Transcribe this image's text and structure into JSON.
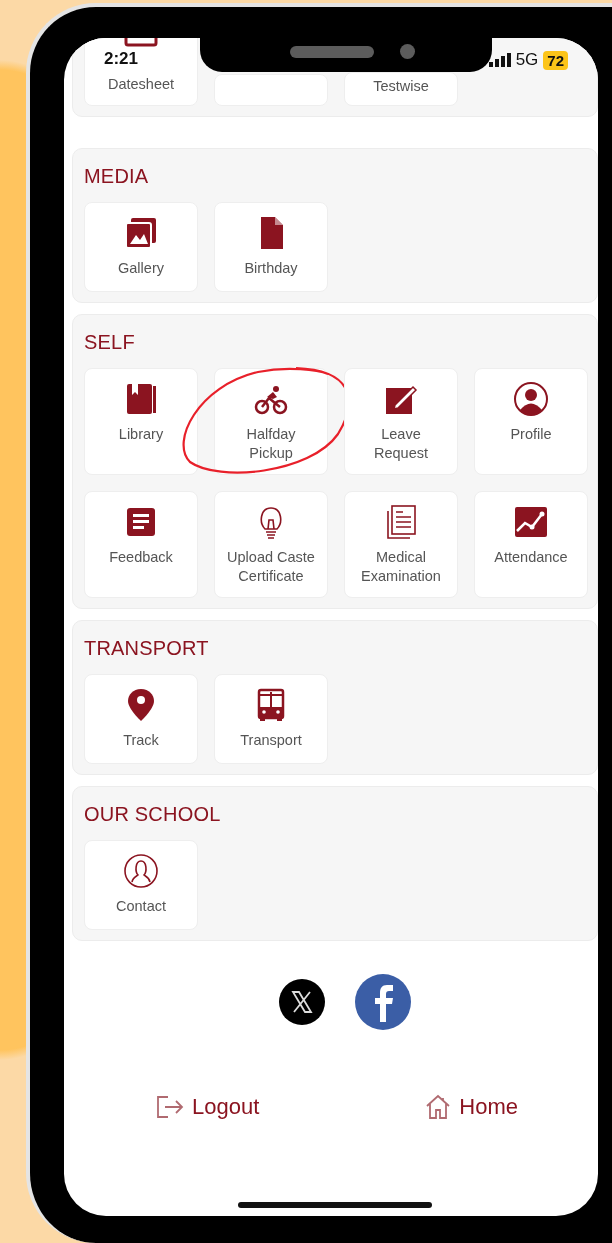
{
  "status_bar": {
    "time": "2:21",
    "network": "5G",
    "battery": "72"
  },
  "sections": [
    {
      "tiles": [
        {
          "label": "Datesheet",
          "kind": "calendar",
          "circled": false
        },
        {
          "kind": "hidden",
          "circled": false
        },
        {
          "label": "Testwise",
          "kind": "hidden",
          "circled": false
        }
      ]
    },
    {
      "title": "MEDIA",
      "tiles": [
        {
          "label": "Gallery",
          "kind": "gallery",
          "circled": false
        },
        {
          "label": "Birthday",
          "kind": "file",
          "circled": false
        }
      ]
    },
    {
      "title": "SELF",
      "tiles": [
        {
          "label": "Library",
          "kind": "book",
          "circled": false
        },
        {
          "label": "Halfday Pickup",
          "kind": "bicycle",
          "circled": true
        },
        {
          "label": "Leave Request",
          "kind": "edit",
          "circled": false
        },
        {
          "label": "Profile",
          "kind": "person",
          "circled": false
        },
        {
          "label": "Feedback",
          "kind": "form",
          "circled": false
        },
        {
          "label": "Upload Caste Certificate",
          "kind": "bulb",
          "circled": false
        },
        {
          "label": "Medical Examination",
          "kind": "document",
          "circled": false
        },
        {
          "label": "Attendance",
          "kind": "chart",
          "circled": false
        }
      ]
    },
    {
      "title": "TRANSPORT",
      "tiles": [
        {
          "label": "Track",
          "kind": "pin",
          "circled": false
        },
        {
          "label": "Transport",
          "kind": "bus",
          "circled": false
        }
      ]
    },
    {
      "title": "OUR SCHOOL",
      "tiles": [
        {
          "label": "Contact",
          "kind": "contact",
          "circled": false
        }
      ]
    }
  ],
  "footer": {
    "logout": "Logout",
    "home": "Home"
  }
}
